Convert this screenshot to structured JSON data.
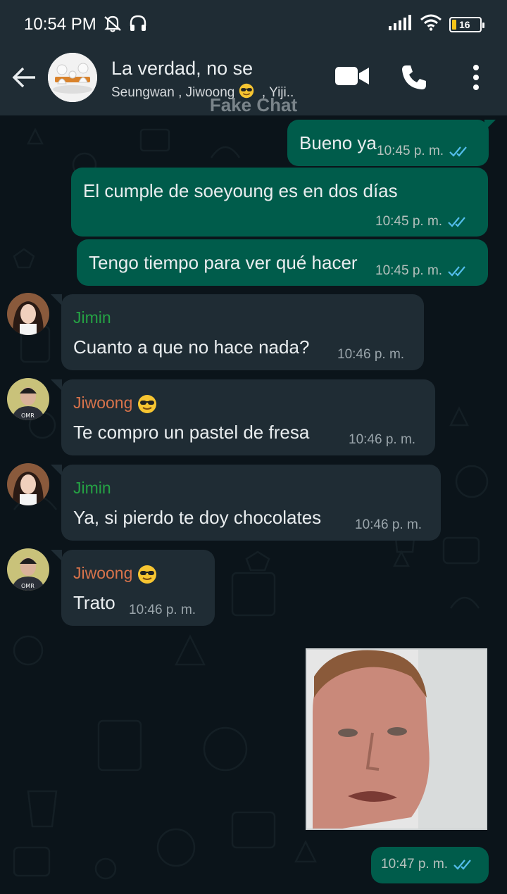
{
  "status_bar": {
    "time": "10:54 PM",
    "battery": "16"
  },
  "header": {
    "title": "La verdad, no se",
    "members": "Seungwan , Jiwoong",
    "members_tail": ", Yiji..",
    "watermark": "Fake Chat"
  },
  "messages": [
    {
      "dir": "out",
      "text": "Bueno ya",
      "time": "10:45 p. m."
    },
    {
      "dir": "out",
      "text": "El cumple de soeyoung es en dos días",
      "time": "10:45 p. m."
    },
    {
      "dir": "out",
      "text": "Tengo tiempo para ver qué hacer",
      "time": "10:45 p. m."
    },
    {
      "dir": "in",
      "sender": "Jimin",
      "text": "Cuanto a que no hace nada?",
      "time": "10:46 p. m."
    },
    {
      "dir": "in",
      "sender": "Jiwoong",
      "text": "Te compro un pastel de fresa",
      "time": "10:46 p. m."
    },
    {
      "dir": "in",
      "sender": "Jimin",
      "text": "Ya, si pierdo te doy chocolates",
      "time": "10:46 p. m."
    },
    {
      "dir": "in",
      "sender": "Jiwoong",
      "text": "Trato",
      "time": "10:46 p. m."
    },
    {
      "dir": "out",
      "type": "image",
      "time": "10:47 p. m."
    }
  ],
  "colors": {
    "outgoing_bubble": "#005c4b",
    "incoming_bubble": "#1f2c34",
    "jimin_name": "#25a244",
    "jiwoong_name": "#d8734b",
    "read_ticks": "#53bdeb"
  },
  "icons": [
    "back-arrow-icon",
    "video-call-icon",
    "phone-icon",
    "more-options-icon",
    "muted-bell-icon",
    "headphones-icon",
    "signal-icon",
    "wifi-icon",
    "battery-icon",
    "sunglasses-emoji-icon",
    "double-check-icon"
  ]
}
